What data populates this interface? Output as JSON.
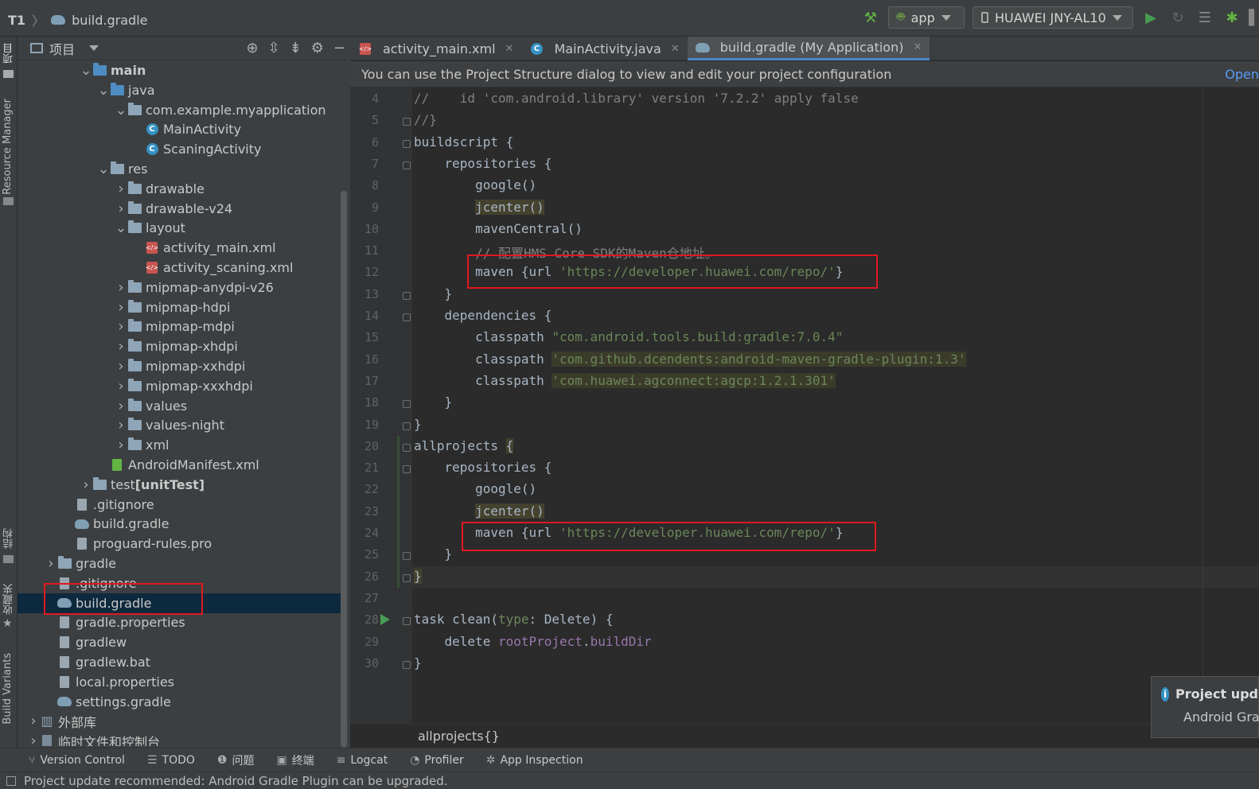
{
  "top": {
    "project": "T1",
    "file": "build.gradle",
    "run_config": "app",
    "device": "HUAWEI JNY-AL10"
  },
  "leftstrip": {
    "project_label": "项目",
    "resource_manager": "Resource Manager",
    "structure": "结构",
    "favorites": "收藏夹",
    "build_variants": "Build Variants"
  },
  "project_panel": {
    "title": "项目",
    "tree": [
      {
        "label": "main",
        "depth": 3,
        "arrow": "down",
        "icon": "folder-blue",
        "bold": true
      },
      {
        "label": "java",
        "depth": 4,
        "arrow": "down",
        "icon": "folder-blue"
      },
      {
        "label": "com.example.myapplication",
        "depth": 5,
        "arrow": "down",
        "icon": "folder"
      },
      {
        "label": "MainActivity",
        "depth": 6,
        "arrow": "",
        "icon": "class"
      },
      {
        "label": "ScaningActivity",
        "depth": 6,
        "arrow": "",
        "icon": "class"
      },
      {
        "label": "res",
        "depth": 4,
        "arrow": "down",
        "icon": "folder"
      },
      {
        "label": "drawable",
        "depth": 5,
        "arrow": "right",
        "icon": "folder"
      },
      {
        "label": "drawable-v24",
        "depth": 5,
        "arrow": "right",
        "icon": "folder"
      },
      {
        "label": "layout",
        "depth": 5,
        "arrow": "down",
        "icon": "folder"
      },
      {
        "label": "activity_main.xml",
        "depth": 6,
        "arrow": "",
        "icon": "xml"
      },
      {
        "label": "activity_scaning.xml",
        "depth": 6,
        "arrow": "",
        "icon": "xml"
      },
      {
        "label": "mipmap-anydpi-v26",
        "depth": 5,
        "arrow": "right",
        "icon": "folder"
      },
      {
        "label": "mipmap-hdpi",
        "depth": 5,
        "arrow": "right",
        "icon": "folder"
      },
      {
        "label": "mipmap-mdpi",
        "depth": 5,
        "arrow": "right",
        "icon": "folder"
      },
      {
        "label": "mipmap-xhdpi",
        "depth": 5,
        "arrow": "right",
        "icon": "folder"
      },
      {
        "label": "mipmap-xxhdpi",
        "depth": 5,
        "arrow": "right",
        "icon": "folder"
      },
      {
        "label": "mipmap-xxxhdpi",
        "depth": 5,
        "arrow": "right",
        "icon": "folder"
      },
      {
        "label": "values",
        "depth": 5,
        "arrow": "right",
        "icon": "folder"
      },
      {
        "label": "values-night",
        "depth": 5,
        "arrow": "right",
        "icon": "folder"
      },
      {
        "label": "xml",
        "depth": 5,
        "arrow": "right",
        "icon": "folder"
      },
      {
        "label": "AndroidManifest.xml",
        "depth": 4,
        "arrow": "",
        "icon": "manifest"
      },
      {
        "label": "test",
        "suffix": "[unitTest]",
        "depth": 3,
        "arrow": "right",
        "icon": "folder"
      },
      {
        "label": ".gitignore",
        "depth": 2,
        "arrow": "",
        "icon": "file"
      },
      {
        "label": "build.gradle",
        "depth": 2,
        "arrow": "",
        "icon": "gradle"
      },
      {
        "label": "proguard-rules.pro",
        "depth": 2,
        "arrow": "",
        "icon": "file"
      },
      {
        "label": "gradle",
        "depth": 1,
        "arrow": "right",
        "icon": "folder"
      },
      {
        "label": ".gitignore",
        "depth": 1,
        "arrow": "",
        "icon": "file"
      },
      {
        "label": "build.gradle",
        "depth": 1,
        "arrow": "",
        "icon": "gradle",
        "selected": true
      },
      {
        "label": "gradle.properties",
        "depth": 1,
        "arrow": "",
        "icon": "file"
      },
      {
        "label": "gradlew",
        "depth": 1,
        "arrow": "",
        "icon": "file"
      },
      {
        "label": "gradlew.bat",
        "depth": 1,
        "arrow": "",
        "icon": "file"
      },
      {
        "label": "local.properties",
        "depth": 1,
        "arrow": "",
        "icon": "file"
      },
      {
        "label": "settings.gradle",
        "depth": 1,
        "arrow": "",
        "icon": "gradle"
      },
      {
        "label": "外部库",
        "depth": 0,
        "arrow": "right",
        "icon": "library"
      },
      {
        "label": "临时文件和控制台",
        "depth": 0,
        "arrow": "right",
        "icon": "scratch"
      }
    ]
  },
  "tabs": [
    {
      "label": "activity_main.xml",
      "icon": "xml",
      "active": false
    },
    {
      "label": "MainActivity.java",
      "icon": "class",
      "active": false
    },
    {
      "label": "build.gradle (My Application)",
      "icon": "gradle",
      "active": true
    }
  ],
  "notice": {
    "text": "You can use the Project Structure dialog to view and edit your project configuration",
    "action": "Open"
  },
  "code_lines": [
    {
      "n": "4",
      "html": "<span class=\"cm\">//    id 'com.android.library' version '7.2.2' apply false</span>"
    },
    {
      "n": "5",
      "html": "<span class=\"cm\">//}</span>"
    },
    {
      "n": "6",
      "html": "buildscript {"
    },
    {
      "n": "7",
      "html": "    repositories {"
    },
    {
      "n": "8",
      "html": "        google()"
    },
    {
      "n": "9",
      "html": "        <span class=\"hl2\">jcenter()</span>"
    },
    {
      "n": "10",
      "html": "        mavenCentral()"
    },
    {
      "n": "11",
      "html": "        <span class=\"cm\">// 配置HMS Core SDK的Maven仓地址。</span>"
    },
    {
      "n": "12",
      "html": "        maven {url <span class=\"str\">'https://developer.huawei.com/repo/'</span>}"
    },
    {
      "n": "13",
      "html": "    }"
    },
    {
      "n": "14",
      "html": "    dependencies {"
    },
    {
      "n": "15",
      "html": "        classpath <span class=\"str\">\"com.android.tools.build:gradle:7.0.4\"</span>"
    },
    {
      "n": "16",
      "html": "        classpath <span class=\"str hl\">'com.github.dcendents:android-maven-gradle-plugin:1.3'</span>"
    },
    {
      "n": "17",
      "html": "        classpath <span class=\"str hl\">'com.huawei.agconnect:agcp:1.2.1.301'</span>"
    },
    {
      "n": "18",
      "html": "    }"
    },
    {
      "n": "19",
      "html": "}"
    },
    {
      "n": "20",
      "html": "allprojects <span class=\"hl2\">{</span>"
    },
    {
      "n": "21",
      "html": "    repositories {"
    },
    {
      "n": "22",
      "html": "        google()"
    },
    {
      "n": "23",
      "html": "        <span class=\"hl2\">jcenter()</span>"
    },
    {
      "n": "24",
      "html": "        maven {url <span class=\"str\">'https://developer.huawei.com/repo/'</span>}"
    },
    {
      "n": "25",
      "html": "    }"
    },
    {
      "n": "26",
      "html": "<span class=\"hl2\">}</span>"
    },
    {
      "n": "27",
      "html": ""
    },
    {
      "n": "28",
      "html": "task clean(<span class=\"prm\">type</span>: Delete) {"
    },
    {
      "n": "29",
      "html": "    delete <span class=\"pv\">rootProject</span>.<span class=\"pv\">buildDir</span>"
    },
    {
      "n": "30",
      "html": "}"
    }
  ],
  "editor_crumb": "allprojects{}",
  "toast": {
    "title": "Project upd",
    "body": "Android Gra"
  },
  "bottom_tools": [
    {
      "label": "Version Control",
      "icon": "vcs-icon",
      "glyph": "⑂"
    },
    {
      "label": "TODO",
      "icon": "todo-icon",
      "glyph": "☰"
    },
    {
      "label": "问题",
      "icon": "problems-icon",
      "glyph": "❶"
    },
    {
      "label": "终端",
      "icon": "terminal-icon",
      "glyph": "▣"
    },
    {
      "label": "Logcat",
      "icon": "logcat-icon",
      "glyph": "≡"
    },
    {
      "label": "Profiler",
      "icon": "profiler-icon",
      "glyph": "◔"
    },
    {
      "label": "App Inspection",
      "icon": "inspection-icon",
      "glyph": "✲"
    }
  ],
  "status": "Project update recommended: Android Gradle Plugin can be upgraded."
}
